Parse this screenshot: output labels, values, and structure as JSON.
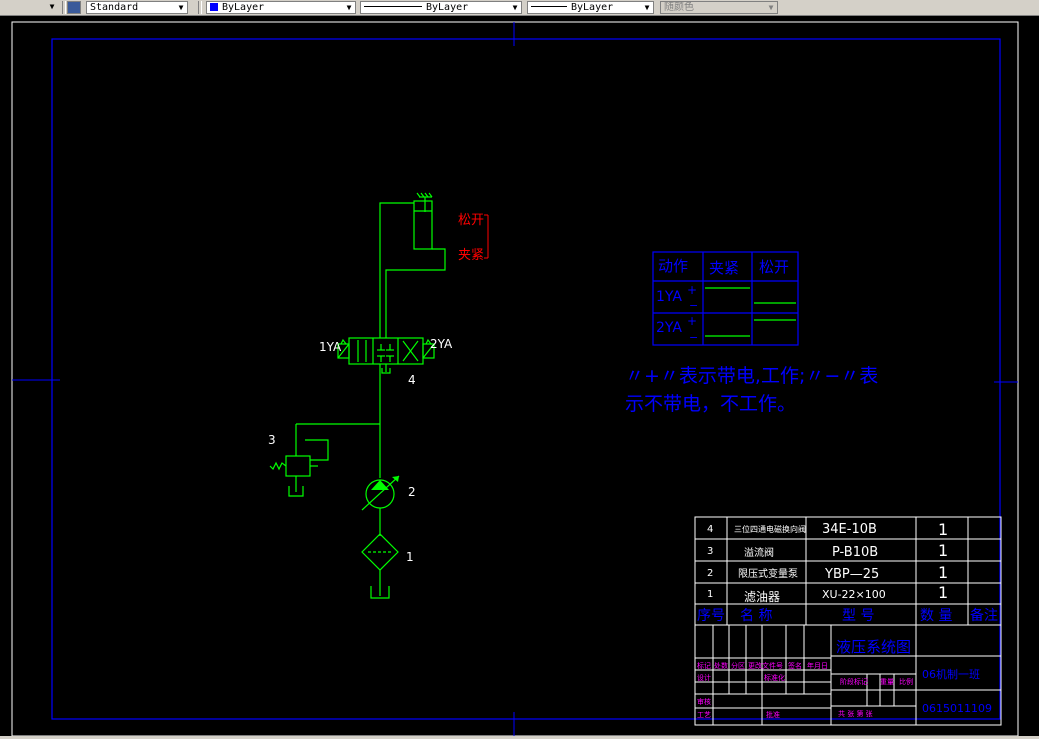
{
  "toolbar": {
    "text_style": "Standard",
    "layer_color": "ByLayer",
    "linetype": "ByLayer",
    "lineweight": "ByLayer",
    "plot_style": "随颜色",
    "colors": {
      "swatch": "#0000ff"
    }
  },
  "drawing": {
    "labels": {
      "release": "松开",
      "clamp": "夹紧",
      "sol_left": "1YA",
      "sol_right": "2YA",
      "n4": "4",
      "n3": "3",
      "n2": "2",
      "n1": "1"
    },
    "state_table": {
      "headers": [
        "动作",
        "夹紧",
        "松开"
      ],
      "rows": [
        {
          "name": "1YA",
          "plus": "+",
          "minus": "−"
        },
        {
          "name": "2YA",
          "plus": "+",
          "minus": "−"
        }
      ]
    },
    "note": {
      "line1": "〃+〃表示带电,工作;〃−〃表",
      "line2": "示不带电，不工作。"
    },
    "parts": [
      {
        "no": "4",
        "name": "三位四通电磁换向阀",
        "model": "34E-10B",
        "qty": "1"
      },
      {
        "no": "3",
        "name": "溢流阀",
        "model": "P-B10B",
        "qty": "1"
      },
      {
        "no": "2",
        "name": "限压式变量泵",
        "model": "YBP—25",
        "qty": "1"
      },
      {
        "no": "1",
        "name": "滤油器",
        "model": "XU-22×100",
        "qty": "1"
      }
    ],
    "parts_header": {
      "no": "序号",
      "name": "名 称",
      "model": "型 号",
      "qty": "数 量",
      "remark": "备注"
    },
    "title_block": {
      "title": "液压系统图",
      "class": "06机制一班",
      "student_no": "0615011109",
      "row1": [
        "标记",
        "处数",
        "分区",
        "更改文件号",
        "签名",
        "年月日"
      ],
      "row2": [
        "设计",
        "",
        "",
        "标准化"
      ],
      "stage": [
        "阶段标记",
        "重量",
        "比例"
      ],
      "check": "审核",
      "process": "工艺",
      "approve": "批准",
      "sheets": "共 张 第 张"
    }
  }
}
